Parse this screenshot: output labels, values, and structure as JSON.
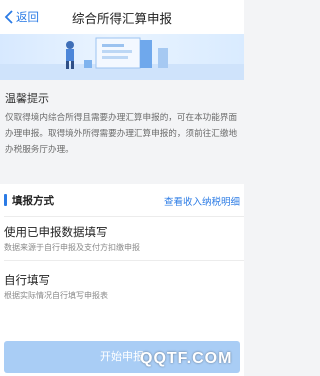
{
  "navbar": {
    "back_label": "返回",
    "title": "综合所得汇算申报"
  },
  "tips": {
    "title": "温馨提示",
    "body": "仅取得境内综合所得且需要办理汇算申报的，可在本功能界面办理申报。取得境外所得需要办理汇算申报的，须前往汇缴地办税服务厅办理。"
  },
  "fill_method": {
    "title": "填报方式",
    "link": "查看收入纳税明细",
    "options": [
      {
        "title": "使用已申报数据填写",
        "subtitle": "数据来源于自行申报及支付方扣缴申报"
      },
      {
        "title": "自行填写",
        "subtitle": "根据实际情况自行填写申报表"
      }
    ]
  },
  "footer": {
    "start_label": "开始申报"
  },
  "watermark": {
    "text": "QQTF.COM"
  },
  "colors": {
    "accent": "#2b7be5",
    "button_disabled": "#a9cdf5"
  }
}
